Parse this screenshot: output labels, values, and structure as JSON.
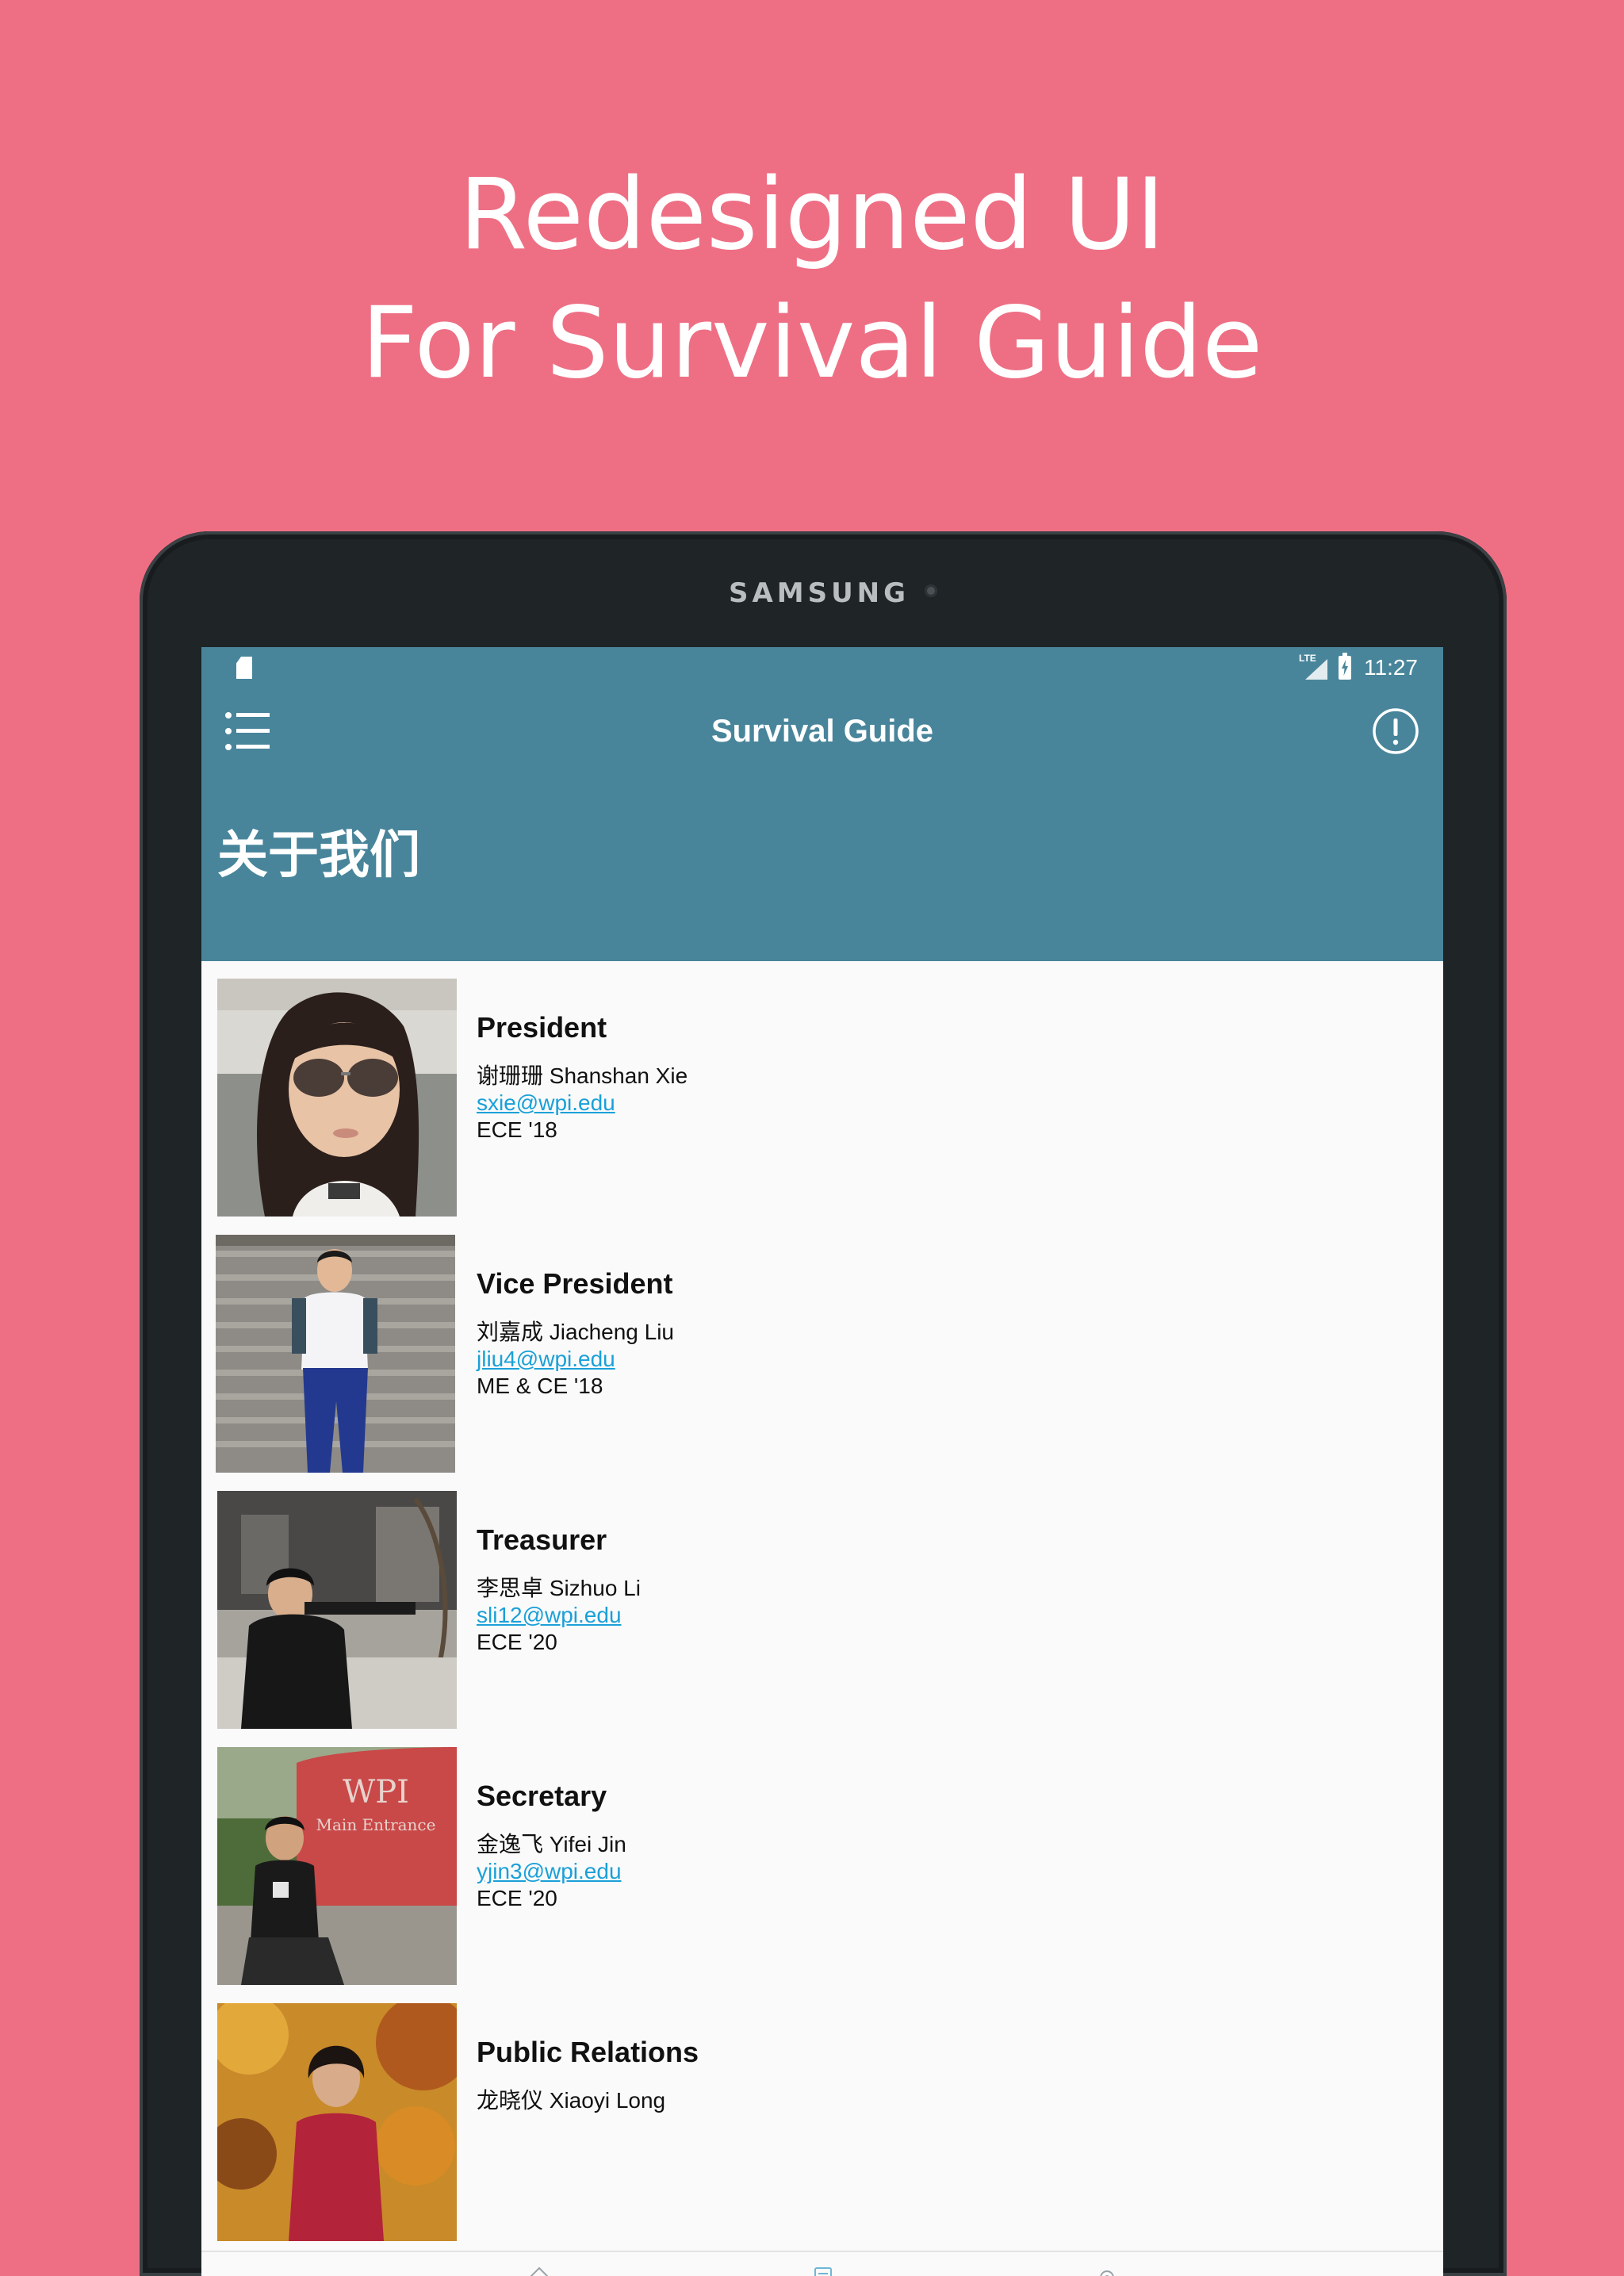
{
  "headline": {
    "line1": "Redesigned UI",
    "line2": "For Survival Guide"
  },
  "device": {
    "brand": "SAMSUNG"
  },
  "status_bar": {
    "network": "LTE",
    "time": "11:27"
  },
  "app_bar": {
    "title": "Survival Guide",
    "menu_icon": "list-menu-icon",
    "info_icon": "info-circle-icon",
    "color": "#48859b"
  },
  "section": {
    "title": "关于我们"
  },
  "members": [
    {
      "role": "President",
      "name": "谢珊珊 Shanshan Xie",
      "email": "sxie@wpi.edu",
      "major": "ECE '18"
    },
    {
      "role": "Vice President",
      "name": "刘嘉成 Jiacheng Liu",
      "email": "jliu4@wpi.edu",
      "major": "ME & CE '18"
    },
    {
      "role": "Treasurer",
      "name": "李思卓 Sizhuo Li",
      "email": "sli12@wpi.edu",
      "major": "ECE '20"
    },
    {
      "role": "Secretary",
      "name": "金逸飞 Yifei Jin",
      "email": "yjin3@wpi.edu",
      "major": "ECE '20"
    },
    {
      "role": "Public Relations",
      "name": "龙晓仪 Xiaoyi Long",
      "email": "",
      "major": ""
    }
  ],
  "photo_text": {
    "sign_title": "WPI",
    "sign_subtitle": "Main Entrance"
  },
  "bottom_nav": {
    "icons": [
      "home-icon",
      "guide-book-icon",
      "gear-icon"
    ]
  },
  "colors": {
    "background": "#ee6f84",
    "link": "#1aa0d8"
  }
}
